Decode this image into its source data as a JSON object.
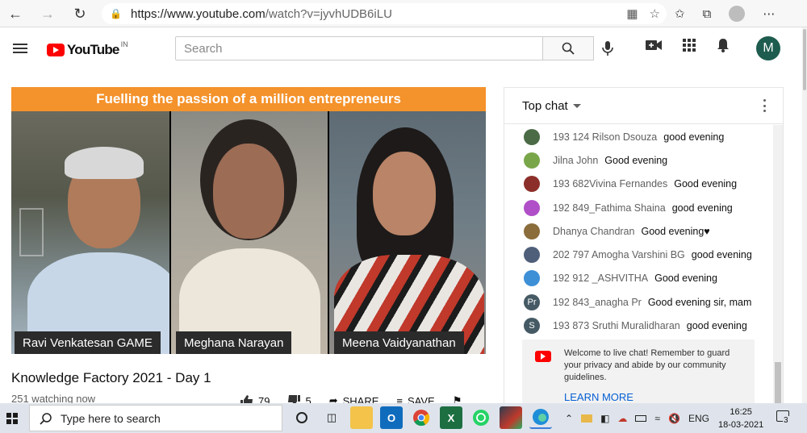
{
  "browser": {
    "url_prefix": "https://www.youtube.com",
    "url_path": "/watch?v=jyvhUDB6iLU"
  },
  "header": {
    "logo_text": "YouTube",
    "region": "IN",
    "search_placeholder": "Search",
    "avatar_letter": "M"
  },
  "video": {
    "banner": "Fuelling the passion of a million entrepreneurs",
    "speakers": [
      "Ravi Venkatesan GAME",
      "Meghana Narayan",
      "Meena Vaidyanathan"
    ],
    "title": "Knowledge Factory 2021 - Day 1",
    "watching": "251 watching now",
    "likes": "79",
    "dislikes": "5",
    "share_label": "SHARE",
    "save_label": "SAVE"
  },
  "chat": {
    "header": "Top chat",
    "messages": [
      {
        "author": "193 124 Rilson Dsouza",
        "text": "good evening",
        "avatar": "",
        "color": "#4a6b45"
      },
      {
        "author": "Jilna John",
        "text": "Good evening",
        "avatar": "",
        "color": "#7aa64a"
      },
      {
        "author": "193 682Vivina Fernandes",
        "text": "Good evening",
        "avatar": "",
        "color": "#8c2f2a"
      },
      {
        "author": "192 849_Fathima Shaina",
        "text": "good evening",
        "avatar": "",
        "color": "#b04fc7"
      },
      {
        "author": "Dhanya Chandran",
        "text": "Good evening♥",
        "avatar": "",
        "color": "#8a6d3b"
      },
      {
        "author": "202 797 Amogha Varshini BG",
        "text": "good evening",
        "avatar": "",
        "color": "#4f5f7a"
      },
      {
        "author": "192 912 _ASHVITHA",
        "text": "Good evening",
        "avatar": "",
        "color": "#3d8fd6"
      },
      {
        "author": "192 843_anagha Pr",
        "text": "Good evening sir, mam",
        "avatar": "Pr",
        "color": "#455a64"
      },
      {
        "author": "193 873 Sruthi Muralidharan",
        "text": "good evening",
        "avatar": "S",
        "color": "#455a64"
      }
    ],
    "welcome_text": "Welcome to live chat! Remember to guard your privacy and abide by our community guidelines.",
    "learn_more": "LEARN MORE"
  },
  "taskbar": {
    "search_placeholder": "Type here to search",
    "language": "ENG",
    "time": "16:25",
    "date": "18-03-2021",
    "notifications": "3"
  }
}
